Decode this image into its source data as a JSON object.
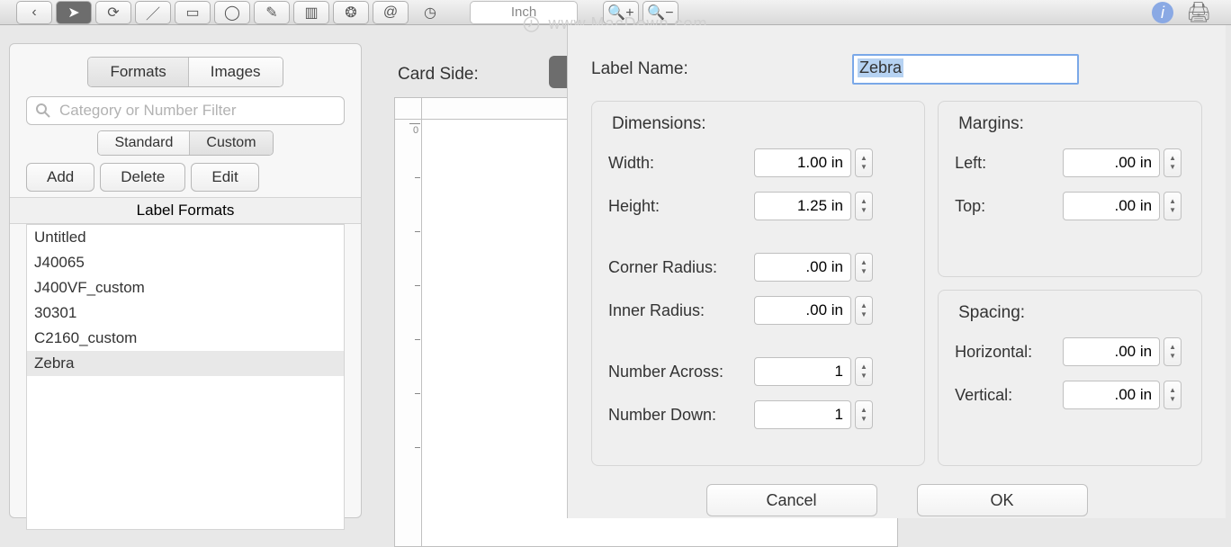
{
  "toolbar": {
    "unit": "Inch"
  },
  "watermark": "www.MacDown.com",
  "segments": {
    "formats": "Formats",
    "images": "Images",
    "standard": "Standard",
    "custom": "Custom"
  },
  "search": {
    "placeholder": "Category or Number Filter"
  },
  "actions": {
    "add": "Add",
    "delete": "Delete",
    "edit": "Edit"
  },
  "list": {
    "header": "Label Formats",
    "items": [
      "Untitled",
      "J40065",
      "J400VF_custom",
      "30301",
      "C2160_custom",
      "Zebra"
    ],
    "selected": 5
  },
  "canvas": {
    "card_side": "Card Side:"
  },
  "dialog": {
    "label_name": "Label Name:",
    "label_name_value": "Zebra",
    "dimensions_title": "Dimensions:",
    "margins_title": "Margins:",
    "spacing_title": "Spacing:",
    "fields": {
      "width": {
        "label": "Width:",
        "value": "1.00 in"
      },
      "height": {
        "label": "Height:",
        "value": "1.25 in"
      },
      "corner_radius": {
        "label": "Corner Radius:",
        "value": ".00 in"
      },
      "inner_radius": {
        "label": "Inner Radius:",
        "value": ".00 in"
      },
      "number_across": {
        "label": "Number Across:",
        "value": "1"
      },
      "number_down": {
        "label": "Number Down:",
        "value": "1"
      },
      "left": {
        "label": "Left:",
        "value": ".00 in"
      },
      "top": {
        "label": "Top:",
        "value": ".00 in"
      },
      "horizontal": {
        "label": "Horizontal:",
        "value": ".00 in"
      },
      "vertical": {
        "label": "Vertical:",
        "value": ".00 in"
      }
    },
    "buttons": {
      "cancel": "Cancel",
      "ok": "OK"
    }
  }
}
